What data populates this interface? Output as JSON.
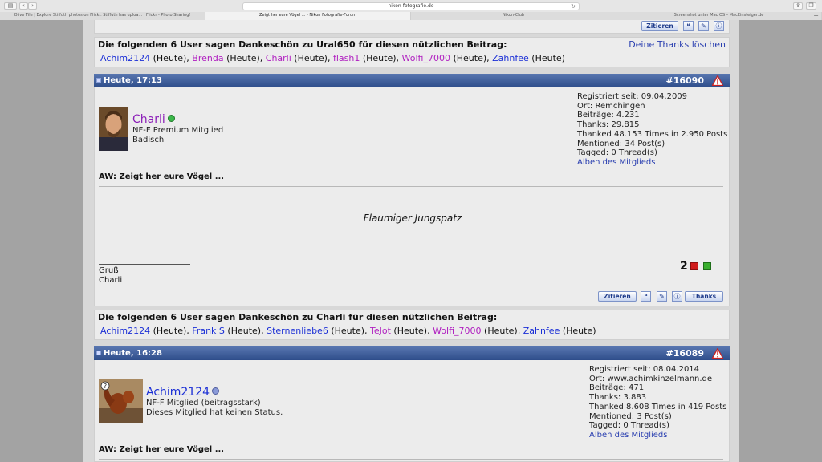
{
  "browser": {
    "url": "nikon-fotografie.de",
    "tabs": [
      "Olive Tile | Explore Stiffuth photos on Flickr. Stiffuth has uploa... | Flickr - Photo Sharing!",
      "Zeigt her eure Vögel ... - Nikon Fotografie-Forum",
      "Nikon-Club",
      "Screenshot unter Mac OS – MacEinsteiger.de"
    ]
  },
  "buttons": {
    "quote": "Zitieren",
    "thanks": "Thanks"
  },
  "thanks_block_1": {
    "title": "Die folgenden 6 User sagen Dankeschön zu Ural650 für diesen nützlichen Beitrag:",
    "delete_link": "Deine Thanks löschen",
    "users": [
      {
        "name": "Achim2124",
        "color": "#1b2fd6"
      },
      {
        "name": "Brenda",
        "color": "#b020c0"
      },
      {
        "name": "Charli",
        "color": "#b020c0"
      },
      {
        "name": "flash1",
        "color": "#b020c0"
      },
      {
        "name": "Wolfi_7000",
        "color": "#b020c0"
      },
      {
        "name": "Zahnfee",
        "color": "#1b2fd6"
      }
    ],
    "suffix": "(Heute)"
  },
  "post_1": {
    "date": "Heute, 17:13",
    "number": "#16090",
    "author": "Charli",
    "author_color": "#8c1fb8",
    "rank": "NF-F Premium Mitglied",
    "status": "Badisch",
    "stats": {
      "registered": "Registriert seit: 09.04.2009",
      "location": "Ort: Remchingen",
      "posts": "Beiträge: 4.231",
      "thanks": "Thanks: 29.815",
      "thanked": "Thanked 48.153 Times in 2.950 Posts",
      "mentioned": "Mentioned: 34 Post(s)",
      "tagged": "Tagged: 0 Thread(s)",
      "albums": "Alben des Mitglieds"
    },
    "title": "AW: Zeigt her eure Vögel ...",
    "caption": "Flaumiger Jungspatz",
    "signature": [
      "Gruß",
      "Charli"
    ],
    "likes": "2"
  },
  "thanks_block_2": {
    "title": "Die folgenden 6 User sagen Dankeschön zu Charli für diesen nützlichen Beitrag:",
    "users": [
      {
        "name": "Achim2124",
        "color": "#1b2fd6"
      },
      {
        "name": "Frank S",
        "color": "#1b2fd6"
      },
      {
        "name": "Sternenliebe6",
        "color": "#1b2fd6"
      },
      {
        "name": "TeJot",
        "color": "#b020c0"
      },
      {
        "name": "Wolfi_7000",
        "color": "#b020c0"
      },
      {
        "name": "Zahnfee",
        "color": "#1b2fd6"
      }
    ],
    "suffix": "(Heute)"
  },
  "post_2": {
    "date": "Heute, 16:28",
    "number": "#16089",
    "author": "Achim2124",
    "author_color": "#1b2fd6",
    "rank": "NF-F Mitglied (beitragsstark)",
    "status": "Dieses Mitglied hat keinen Status.",
    "stats": {
      "registered": "Registriert seit: 08.04.2014",
      "location": "Ort: www.achimkinzelmann.de",
      "posts": "Beiträge: 471",
      "thanks": "Thanks: 3.883",
      "thanked": "Thanked 8.608 Times in 419 Posts",
      "mentioned": "Mentioned: 3 Post(s)",
      "tagged": "Tagged: 0 Thread(s)",
      "albums": "Alben des Mitglieds"
    },
    "title": "AW: Zeigt her eure Vögel ..."
  }
}
